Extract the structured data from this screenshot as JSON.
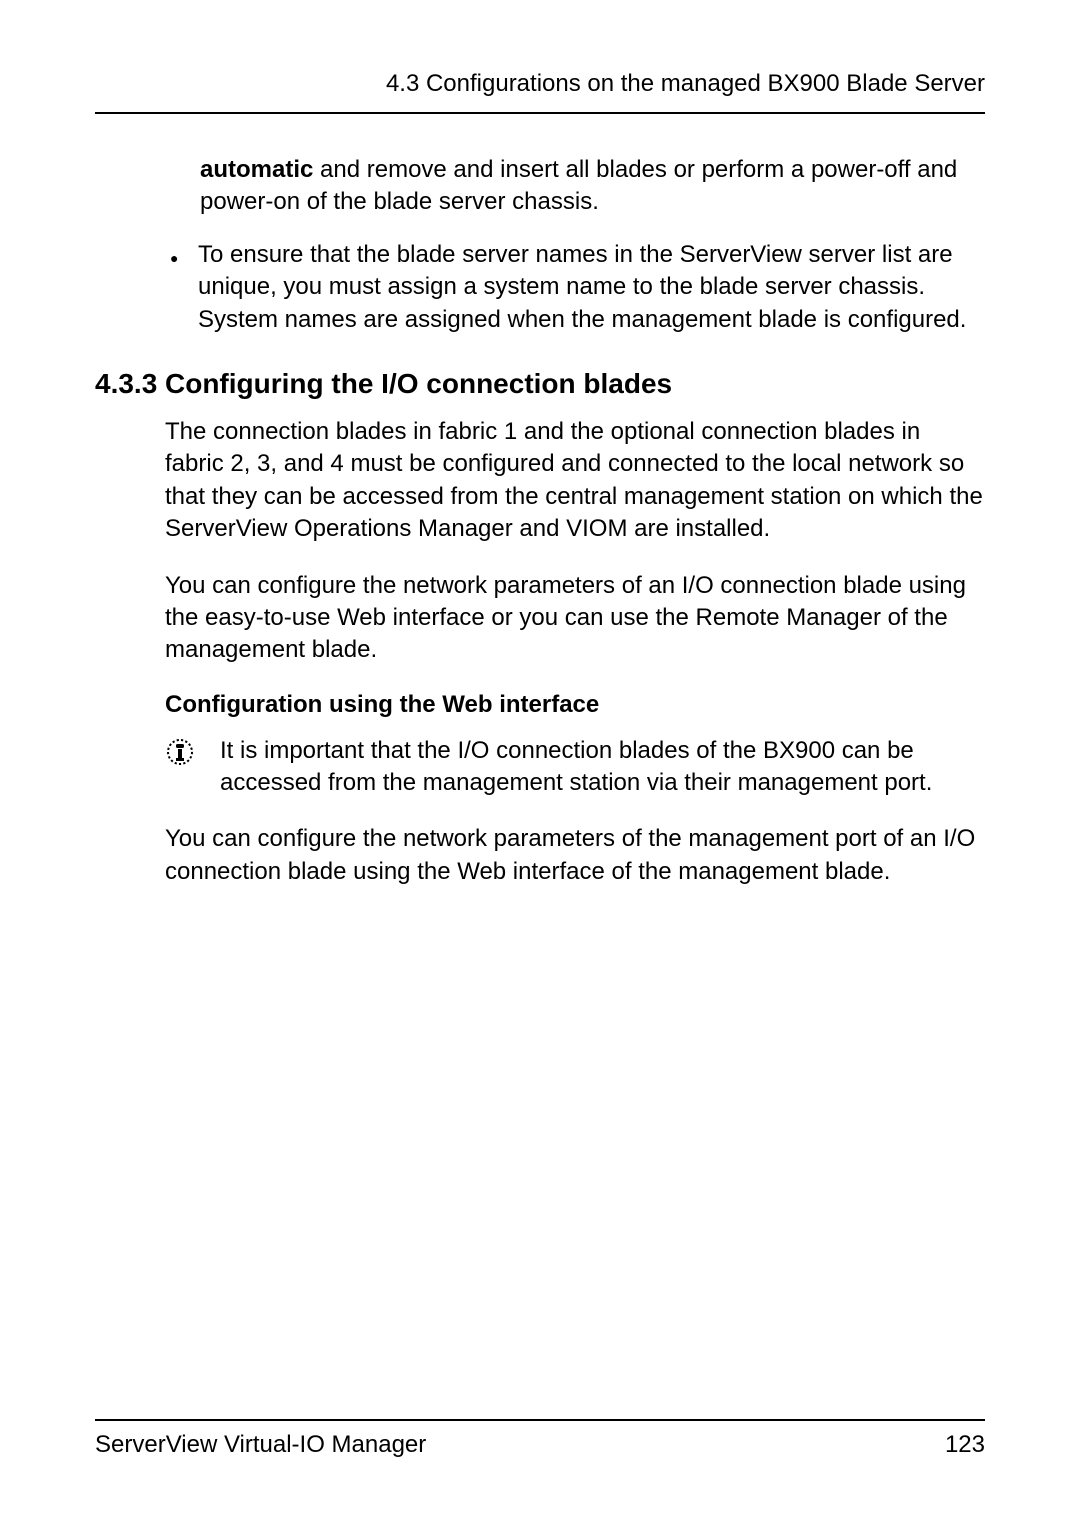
{
  "header": {
    "section_path": "4.3 Configurations on the managed BX900 Blade Server"
  },
  "intro_continuation": {
    "bold": "automatic",
    "rest": " and remove and insert all blades or perform a power-off and power-on of the blade server chassis."
  },
  "bullet": {
    "text": "To ensure that the blade server names in the ServerView server list are unique, you must assign a system name to the blade server chassis. System names are assigned when the management blade is configured."
  },
  "section": {
    "number": "4.3.3",
    "title": "Configuring the I/O connection blades"
  },
  "paragraphs": {
    "p1": "The connection blades in fabric 1 and the optional connection blades in fabric 2, 3, and 4 must be configured and connected to the local network so that they can be accessed from the central management station on which the ServerView Operations Manager and VIOM are installed.",
    "p2": "You can configure the network parameters of an I/O connection blade using the easy-to-use Web interface or you can use the Remote Manager of the management blade.",
    "subheading": "Configuration using the Web interface",
    "info": "It is important that the I/O connection blades of the BX900 can be accessed from the management station via their management port.",
    "p3": "You can configure the network parameters of the management port of an I/O connection blade using the Web interface of the management blade."
  },
  "footer": {
    "left": "ServerView Virtual-IO Manager",
    "right": "123"
  }
}
